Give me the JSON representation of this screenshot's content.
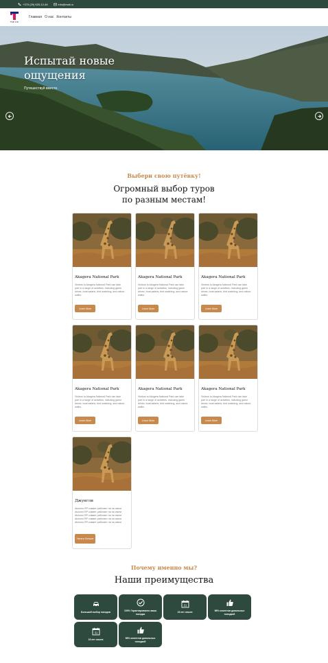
{
  "topbar": {
    "phone": "+375 (29) 625-12-46",
    "email": "info@mail.ru"
  },
  "header": {
    "logo_text": "T R I O",
    "nav": [
      "Главная",
      "О нас",
      "Контакты"
    ]
  },
  "hero": {
    "title": "Испытай новые ощущения",
    "subtitle": "Путешествуй вместе."
  },
  "tours": {
    "kicker": "Выбери свою путёвку!",
    "heading_line1": "Огромный выбор туров",
    "heading_line2": "по разным местам!",
    "cards": [
      {
        "title": "Akagera National Park",
        "desc": "Visitors to Akagera National Park can take part in a range of activities, including game drives, boat safaris, bird watching, and nature walks.",
        "button": "Learn More"
      },
      {
        "title": "Akagera National Park",
        "desc": "Visitors to Akagera National Park can take part in a range of activities, including game drives, boat safaris, bird watching, and nature walks.",
        "button": "Learn More"
      },
      {
        "title": "Akagera National Park",
        "desc": "Visitors to Akagera National Park can take part in a range of activities, including game drives, boat safaris, bird watching, and nature walks.",
        "button": "Learn More"
      },
      {
        "title": "Akagera National Park",
        "desc": "Visitors to Akagera National Park can take part in a range of activities, including game drives, boat safaris, bird watching, and nature walks.",
        "button": "Learn More"
      },
      {
        "title": "Akagera National Park",
        "desc": "Visitors to Akagera National Park can take part in a range of activities, including game drives, boat safaris, bird watching, and nature walks.",
        "button": "Learn More"
      },
      {
        "title": "Akagera National Park",
        "desc": "Visitors to Akagera National Park can take part in a range of activities, including game drives, boat safaris, bird watching, and nature walks.",
        "button": "Learn More"
      },
      {
        "title": "Джунгли",
        "desc": "Alulumo RP совмет работает ли на святи Alulumo RP совмет работает ли на святи Alulumo RP совмет работает ли на святи Alulumo RP совмет работает ли на святи Alulumo RP совмет работает ли на святи",
        "button": "Узнать больше"
      }
    ]
  },
  "advantages": {
    "kicker": "Почему именно мы?",
    "heading": "Наши преимущества",
    "items": [
      {
        "icon": "car-icon",
        "label": "Большой выбор походов"
      },
      {
        "icon": "check-circle-icon",
        "label": "100% Гарантированно ваша поездка"
      },
      {
        "icon": "calendar-icon",
        "label": "15 лет опыта",
        "day": "31"
      },
      {
        "icon": "thumbs-up-icon",
        "label": "98% клиентов довольных поездкой"
      },
      {
        "icon": "calendar-icon",
        "label": "15 лет опыта",
        "day": "31"
      },
      {
        "icon": "thumbs-up-icon",
        "label": "98% клиентов довольных поездкой"
      }
    ]
  },
  "colors": {
    "primary": "#2e4a3e",
    "accent": "#c8894d"
  }
}
